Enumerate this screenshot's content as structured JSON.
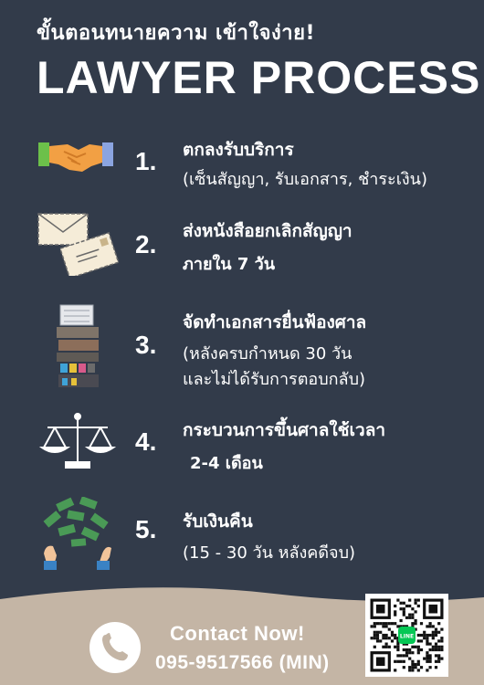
{
  "header": {
    "subtitle": "ขั้นตอนทนายความ เข้าใจง่าย!",
    "title": "LAWYER PROCESS"
  },
  "steps": [
    {
      "number": "1.",
      "line1": "ตกลงรับบริการ",
      "line2": "(เซ็นสัญญา, รับเอกสาร, ชำระเงิน)",
      "icon": "handshake-icon"
    },
    {
      "number": "2.",
      "line1": "ส่งหนังสือยกเลิกสัญญา",
      "line2": "ภายใน 7 วัน",
      "icon": "envelopes-icon"
    },
    {
      "number": "3.",
      "line1": "จัดทำเอกสารยื่นฟ้องศาล",
      "line2": "(หลังครบกำหนด 30 วัน",
      "line3": "และไม่ได้รับการตอบกลับ)",
      "icon": "document-stack-icon"
    },
    {
      "number": "4.",
      "line1": "กระบวนการขึ้นศาลใช้เวลา",
      "line2": "2-4 เดือน",
      "icon": "scales-icon"
    },
    {
      "number": "5.",
      "line1": "รับเงินคืน",
      "line2": "(15 - 30 วัน หลังคดีจบ)",
      "icon": "money-hands-icon"
    }
  ],
  "footer": {
    "contact": "Contact Now!",
    "phone": "095-9517566 (MIN)",
    "qr_badge": "LINE"
  },
  "colors": {
    "background": "#323b4a",
    "footer_band": "#c4b5a5",
    "text": "#ffffff",
    "line_green": "#06c755"
  }
}
